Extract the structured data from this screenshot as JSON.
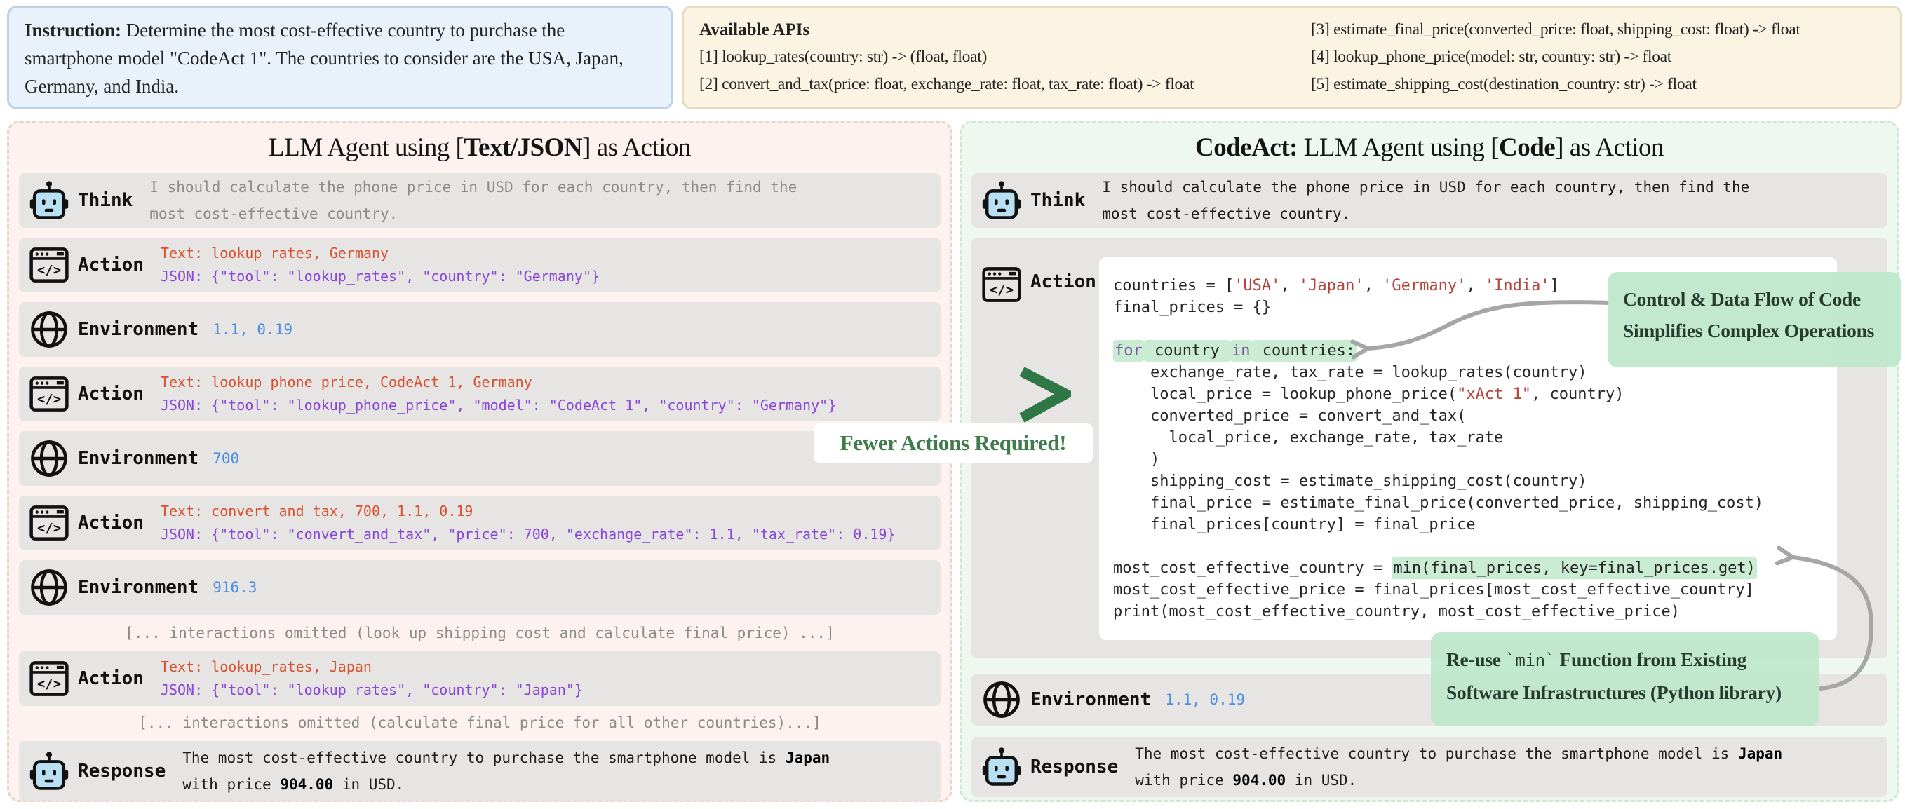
{
  "header": {
    "instruction_label": "Instruction:",
    "instruction_text": " Determine the most cost-effective country to purchase the smartphone model \"CodeAct 1\". The countries to consider are the USA, Japan, Germany, and India.",
    "apis_title": "Available APIs",
    "apis_col1": [
      "[1] lookup_rates(country: str) -> (float, float)",
      "[2] convert_and_tax(price: float, exchange_rate: float, tax_rate: float) -> float"
    ],
    "apis_col2": [
      "[3] estimate_final_price(converted_price: float, shipping_cost: float) -> float",
      "[4] lookup_phone_price(model: str, country: str) -> float",
      "[5] estimate_shipping_cost(destination_country: str) -> float"
    ]
  },
  "left": {
    "title_pre": "LLM Agent using [",
    "title_bold": "Text/JSON",
    "title_post": "] as Action",
    "think_label": "Think",
    "action_label": "Action",
    "env_label": "Environment",
    "response_label": "Response",
    "think_text": "I should calculate the phone price in USD for each country, then find the most cost-effective country.",
    "actions": [
      {
        "text": "Text: lookup_rates, Germany",
        "json": "JSON: {\"tool\": \"lookup_rates\", \"country\": \"Germany\"}"
      },
      {
        "text": "Text: lookup_phone_price, CodeAct 1, Germany",
        "json": "JSON: {\"tool\": \"lookup_phone_price\", \"model\": \"CodeAct 1\", \"country\": \"Germany\"}"
      },
      {
        "text": "Text: convert_and_tax, 700, 1.1, 0.19",
        "json": "JSON: {\"tool\": \"convert_and_tax\", \"price\": 700, \"exchange_rate\": 1.1, \"tax_rate\": 0.19}"
      },
      {
        "text": "Text: lookup_rates, Japan",
        "json": "JSON: {\"tool\": \"lookup_rates\", \"country\": \"Japan\"}"
      }
    ],
    "envs": [
      "1.1, 0.19",
      "700",
      "916.3"
    ],
    "omitted1": "[... interactions omitted (look up shipping cost and calculate final price) ...]",
    "omitted2": "[... interactions omitted (calculate final price for all other countries)...]",
    "response_pre": "The most cost-effective country to purchase the smartphone model is ",
    "response_bold1": "Japan",
    "response_mid": " with price ",
    "response_bold2": "904.00",
    "response_post": " in USD."
  },
  "right": {
    "title_bold_pre": "CodeAct:",
    "title_pre": " LLM Agent using [",
    "title_bold": "Code",
    "title_post": "] as Action",
    "think_label": "Think",
    "action_label": "Action",
    "env_label": "Environment",
    "response_label": "Response",
    "think_text": "I should calculate the phone price in USD for each country, then find the most cost-effective country.",
    "env_value": "1.1, 0.19",
    "response_pre": "The most cost-effective country to purchase the smartphone model is ",
    "response_bold1": "Japan",
    "response_mid": " with price ",
    "response_bold2": "904.00",
    "response_post": " in USD.",
    "chevron_symbol": ">",
    "fewer_badge": "Fewer Actions Required!",
    "annotation1_line1": "Control & Data Flow of Code",
    "annotation1_line2": "Simplifies Complex Operations",
    "annotation2_pre": "Re-use ",
    "annotation2_code": "`min`",
    "annotation2_post": " Function from Existing",
    "annotation2_line2": "Software Infrastructures (Python library)",
    "code_lines": [
      [
        {
          "t": "countries = [",
          "c": "p"
        },
        {
          "t": "'USA'",
          "c": "s"
        },
        {
          "t": ", ",
          "c": "p"
        },
        {
          "t": "'Japan'",
          "c": "s"
        },
        {
          "t": ", ",
          "c": "p"
        },
        {
          "t": "'Germany'",
          "c": "s"
        },
        {
          "t": ", ",
          "c": "p"
        },
        {
          "t": "'India'",
          "c": "s"
        },
        {
          "t": "]",
          "c": "p"
        }
      ],
      [
        {
          "t": "final_prices = {}",
          "c": "p"
        }
      ],
      [],
      [
        {
          "t": "for",
          "c": "k",
          "h": true
        },
        {
          "t": " country ",
          "c": "p",
          "h": true
        },
        {
          "t": "in",
          "c": "k",
          "h": true
        },
        {
          "t": " countries:",
          "c": "p",
          "h": true
        }
      ],
      [
        {
          "t": "    exchange_rate, tax_rate = lookup_rates(country)",
          "c": "p"
        }
      ],
      [
        {
          "t": "    local_price = lookup_phone_price(",
          "c": "p"
        },
        {
          "t": "\"xAct 1\"",
          "c": "s"
        },
        {
          "t": ", country)",
          "c": "p"
        }
      ],
      [
        {
          "t": "    converted_price = convert_and_tax(",
          "c": "p"
        }
      ],
      [
        {
          "t": "      local_price, exchange_rate, tax_rate",
          "c": "p"
        }
      ],
      [
        {
          "t": "    )",
          "c": "p"
        }
      ],
      [
        {
          "t": "    shipping_cost = estimate_shipping_cost(country)",
          "c": "p"
        }
      ],
      [
        {
          "t": "    final_price = estimate_final_price(converted_price, shipping_cost)",
          "c": "p"
        }
      ],
      [
        {
          "t": "    final_prices[country] = final_price",
          "c": "p"
        }
      ],
      [],
      [
        {
          "t": "most_cost_effective_country = ",
          "c": "p"
        },
        {
          "t": "min(final_prices, key=final_prices.get)",
          "c": "p",
          "h": true
        }
      ],
      [
        {
          "t": "most_cost_effective_price = final_prices[most_cost_effective_country]",
          "c": "p"
        }
      ],
      [
        {
          "t": "print(most_cost_effective_country, most_cost_effective_price)",
          "c": "p"
        }
      ]
    ]
  },
  "icons": {
    "think": "robot-icon",
    "action": "code-window-icon",
    "environment": "globe-icon",
    "response": "robot-icon"
  },
  "colors": {
    "action_text_red": "#d9502e",
    "action_json_purple": "#8a46da",
    "env_value_blue": "#4a8de2",
    "code_string_red": "#b2423a",
    "code_keyword_purple": "#7d56a5",
    "code_highlight_green": "#c9ecd3",
    "annotation_green": "#bde7ca",
    "badge_text_green": "#3f7b4c",
    "chevron_green": "#2f7746",
    "left_panel_bg": "#fdf2ef",
    "right_panel_bg": "#eef8f1",
    "row_gray": "#e6e5e3",
    "instruction_bg": "#e9f2fb",
    "api_bg": "#fbf4e3"
  }
}
